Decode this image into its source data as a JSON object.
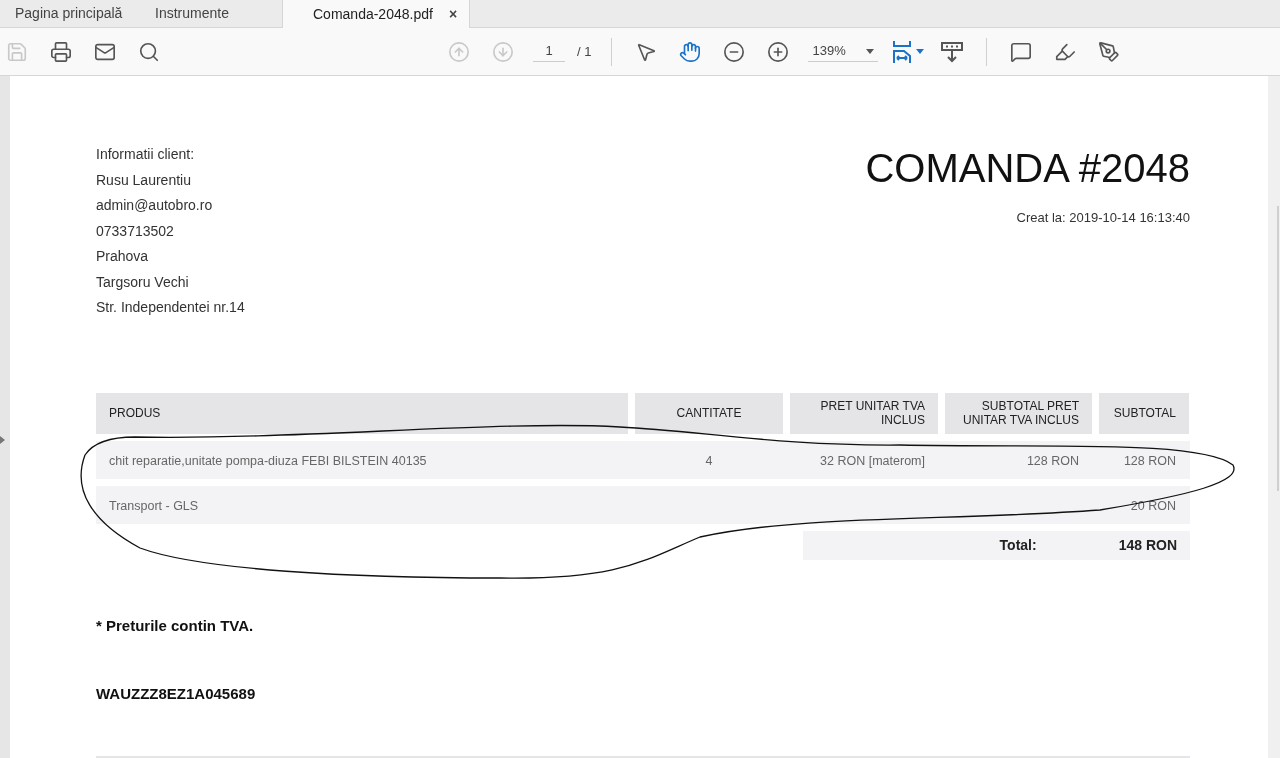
{
  "tabs": [
    {
      "label": "Pagina principală",
      "selected": false
    },
    {
      "label": "Instrumente",
      "selected": false
    },
    {
      "label": "Comanda-2048.pdf",
      "selected": true,
      "close": "×"
    }
  ],
  "toolbar": {
    "left": [
      {
        "kind": "save",
        "disabled": true
      },
      {
        "kind": "print"
      },
      {
        "kind": "mail"
      },
      {
        "kind": "search"
      }
    ],
    "center": [
      {
        "kind": "up",
        "disabled": true
      },
      {
        "kind": "down",
        "disabled": true
      },
      {
        "kind": "page",
        "value": "1",
        "total": "/ 1"
      },
      {
        "kind": "separator"
      },
      {
        "kind": "pointer",
        "selected": false
      },
      {
        "kind": "hand",
        "selected": true
      },
      {
        "kind": "zoom-out"
      },
      {
        "kind": "zoom-in"
      },
      {
        "kind": "zoom",
        "value": "139%"
      },
      {
        "kind": "fit",
        "selected": true
      },
      {
        "kind": "scroll"
      },
      {
        "kind": "separator"
      },
      {
        "kind": "comment"
      },
      {
        "kind": "highlight"
      },
      {
        "kind": "sign"
      }
    ]
  },
  "document": {
    "client_lines": [
      "Informatii client:",
      "Rusu Laurentiu",
      "admin@autobro.ro",
      "0733713502",
      "Prahova",
      "Targsoru Vechi",
      "Str. Independentei nr.14"
    ],
    "title": "COMANDA #2048",
    "created": "Creat la: 2019-10-14 16:13:40",
    "table": {
      "columns": [
        "PRODUS",
        "CANTITATE",
        "PRET UNITAR TVA INCLUS",
        "SUBTOTAL PRET UNITAR TVA INCLUS",
        "SUBTOTAL"
      ],
      "rows": [
        [
          "chit reparatie,unitate pompa-diuza FEBI BILSTEIN 40135",
          "4",
          "32 RON [materom]",
          "128 RON",
          "128 RON"
        ],
        [
          "Transport - GLS",
          "",
          "",
          "",
          "20 RON"
        ]
      ],
      "total_label": "Total:",
      "total_value": "148 RON"
    },
    "note": "* Preturile contin TVA.",
    "vin": "WAUZZZ8EZ1A045689"
  }
}
